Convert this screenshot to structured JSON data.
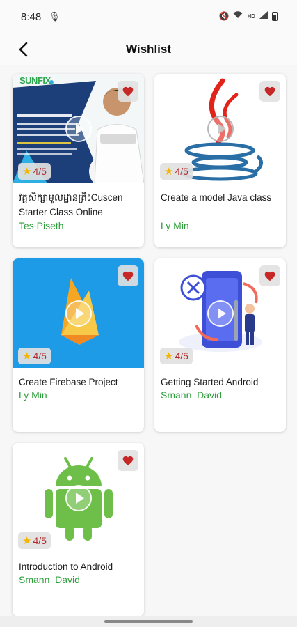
{
  "status_bar": {
    "time": "8:48",
    "network": "HD"
  },
  "app_bar": {
    "title": "Wishlist"
  },
  "courses": [
    {
      "title": "វគ្គសិក្សាមូលដ្ឋានគ្រឹះCuscen Starter Class Online",
      "author": "Tes Piseth",
      "rating": "4/5",
      "thumb_brand": "SUNFIX"
    },
    {
      "title": "Create a model Java class",
      "author": "Ly Min",
      "rating": "4/5"
    },
    {
      "title": "Create Firebase Project",
      "author": "Ly Min",
      "rating": "4/5"
    },
    {
      "title": "Getting Started Android",
      "author": "Smann  David",
      "rating": "4/5"
    },
    {
      "title": "Introduction to Android",
      "author": "Smann  David",
      "rating": "4/5"
    }
  ],
  "colors": {
    "accent_green": "#2e9e3c",
    "heart_red": "#c62828",
    "star": "#f4b400",
    "rating_text": "#b52b2b"
  }
}
